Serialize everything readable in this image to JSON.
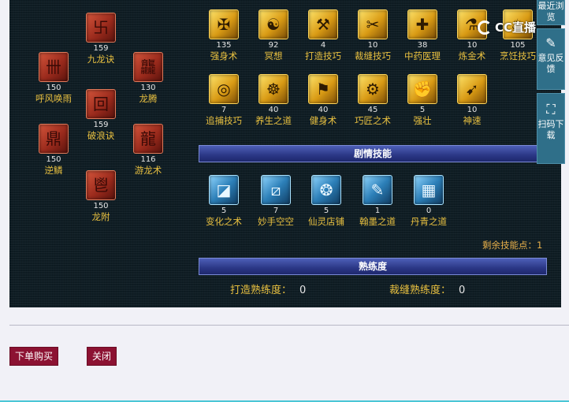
{
  "clan_skills": [
    {
      "name": "九龙诀",
      "level": "159",
      "icon": "nine-dragon-rune-icon",
      "glyph": "卐"
    },
    {
      "name": "呼风唤雨",
      "level": "150",
      "icon": "wind-rain-rune-icon",
      "glyph": "卌"
    },
    {
      "name": "龙腾",
      "level": "130",
      "icon": "dragon-soar-rune-icon",
      "glyph": "龘"
    },
    {
      "name": "破浪诀",
      "level": "159",
      "icon": "wave-break-rune-icon",
      "glyph": "回"
    },
    {
      "name": "逆鳞",
      "level": "150",
      "icon": "reverse-scale-rune-icon",
      "glyph": "鼎"
    },
    {
      "name": "游龙术",
      "level": "116",
      "icon": "wandering-dragon-icon",
      "glyph": "龍"
    },
    {
      "name": "龙附",
      "level": "150",
      "icon": "dragon-attach-rune-icon",
      "glyph": "鬯"
    }
  ],
  "life_skills": [
    {
      "name": "强身术",
      "level": "135",
      "icon": "strengthen-body-icon",
      "glyph": "✠"
    },
    {
      "name": "冥想",
      "level": "92",
      "icon": "meditation-icon",
      "glyph": "☯"
    },
    {
      "name": "打造技巧",
      "level": "4",
      "icon": "forging-icon",
      "glyph": "⚒"
    },
    {
      "name": "裁缝技巧",
      "level": "10",
      "icon": "tailoring-icon",
      "glyph": "✂"
    },
    {
      "name": "中药医理",
      "level": "38",
      "icon": "herbal-medicine-icon",
      "glyph": "✚"
    },
    {
      "name": "炼金术",
      "level": "10",
      "icon": "alchemy-icon",
      "glyph": "⚗"
    },
    {
      "name": "烹饪技巧",
      "level": "105",
      "icon": "cooking-icon",
      "glyph": "♨"
    },
    {
      "name": "追捕技巧",
      "level": "7",
      "icon": "tracking-icon",
      "glyph": "◎"
    },
    {
      "name": "养生之道",
      "level": "40",
      "icon": "health-cultivation-icon",
      "glyph": "☸"
    },
    {
      "name": "健身术",
      "level": "40",
      "icon": "fitness-icon",
      "glyph": "⚑"
    },
    {
      "name": "巧匠之术",
      "level": "45",
      "icon": "craftsman-icon",
      "glyph": "⚙"
    },
    {
      "name": "强壮",
      "level": "5",
      "icon": "strong-icon",
      "glyph": "✊"
    },
    {
      "name": "神速",
      "level": "10",
      "icon": "godspeed-icon",
      "glyph": "➹"
    }
  ],
  "plot_section": {
    "title": "剧情技能"
  },
  "plot_skills": [
    {
      "name": "变化之术",
      "level": "5",
      "icon": "transformation-icon",
      "glyph": "◪"
    },
    {
      "name": "妙手空空",
      "level": "7",
      "icon": "pickpocket-icon",
      "glyph": "⧄"
    },
    {
      "name": "仙灵店铺",
      "level": "5",
      "icon": "fairy-shop-icon",
      "glyph": "❂"
    },
    {
      "name": "翰墨之道",
      "level": "1",
      "icon": "calligraphy-icon",
      "glyph": "✎"
    },
    {
      "name": "丹青之道",
      "level": "0",
      "icon": "painting-icon",
      "glyph": "▦"
    }
  ],
  "remaining_points": {
    "label": "剩余技能点：",
    "value": "1"
  },
  "proficiency_section": {
    "title": "熟练度"
  },
  "proficiency": [
    {
      "label": "打造熟练度：",
      "value": "0"
    },
    {
      "label": "裁缝熟练度：",
      "value": "0"
    }
  ],
  "watermark": {
    "text": "CC直播"
  },
  "side_tools": [
    {
      "label": "最近浏览",
      "icon": "history-icon",
      "glyph": ""
    },
    {
      "label": "意见反馈",
      "icon": "feedback-icon",
      "glyph": "✎"
    },
    {
      "label": "扫码下载",
      "icon": "scan-icon",
      "glyph": "⛶"
    }
  ],
  "buttons": {
    "order": "下单购买",
    "close": "关闭"
  },
  "colors": {
    "panel_bg": "#0f1d24",
    "label_gold": "#e8c040",
    "section_bar": "#2b3785",
    "button": "#8c1232"
  }
}
